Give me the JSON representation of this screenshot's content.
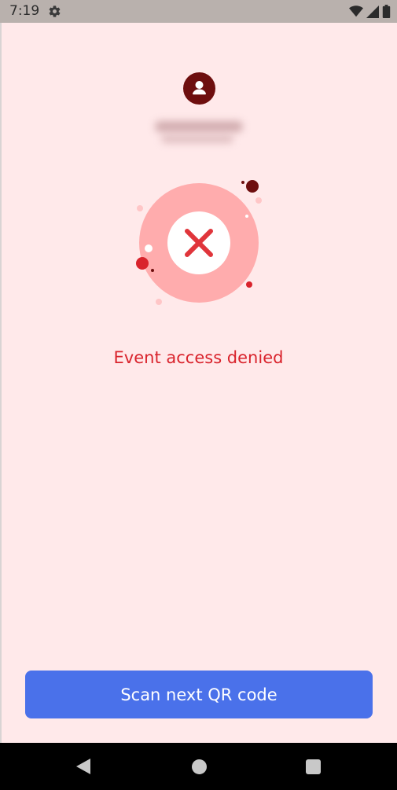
{
  "status_bar": {
    "time": "7:19",
    "icons": [
      "settings-gear-icon",
      "wifi-icon",
      "cellular-signal-icon",
      "battery-icon"
    ]
  },
  "profile": {
    "avatar_icon": "user-avatar-icon",
    "name": "",
    "subtitle": ""
  },
  "result": {
    "icon": "error-x-icon",
    "message": "Event access denied",
    "colors": {
      "error_text": "#d9232c",
      "circle": "#ffacad",
      "x_mark": "#e0353b"
    }
  },
  "actions": {
    "scan_next_label": "Scan next QR code",
    "button_color": "#4a71ea"
  },
  "nav_bar": {
    "icons": [
      "back-icon",
      "home-icon",
      "recents-icon"
    ]
  }
}
